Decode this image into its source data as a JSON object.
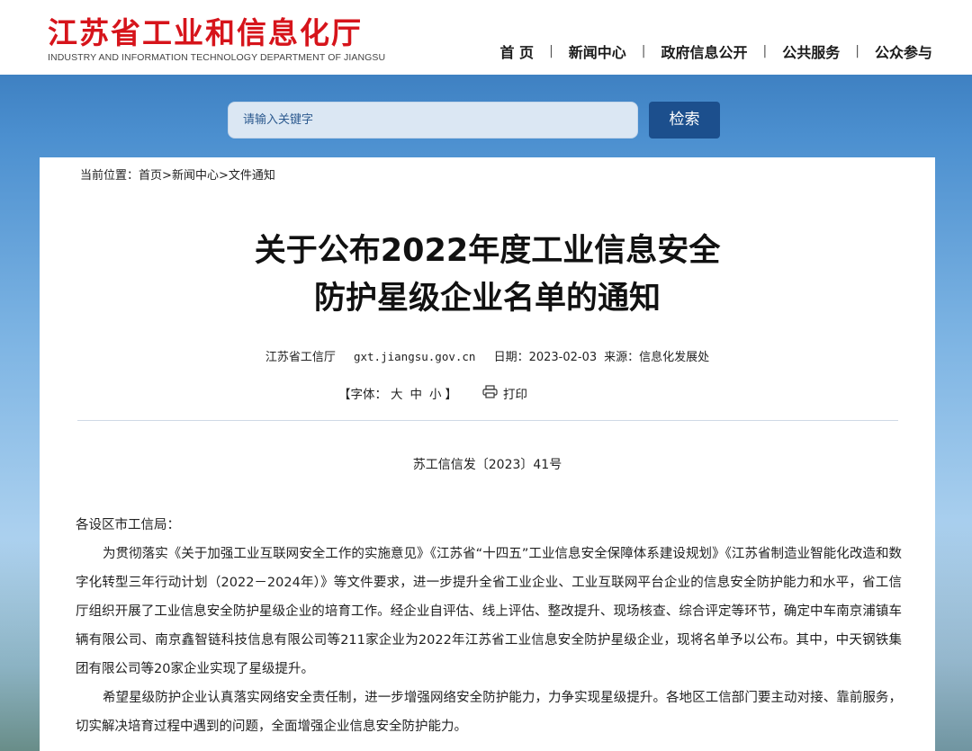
{
  "header": {
    "logo_cn": "江苏省工业和信息化厅",
    "logo_en": "INDUSTRY AND INFORMATION TECHNOLOGY DEPARTMENT OF JIANGSU",
    "nav": [
      "首 页",
      "新闻中心",
      "政府信息公开",
      "公共服务",
      "公众参与"
    ],
    "nav_separator": "|"
  },
  "search": {
    "placeholder": "请输入关键字",
    "button_label": "检索"
  },
  "breadcrumb": {
    "prefix": "当前位置：",
    "items": [
      "首页",
      "新闻中心",
      "文件通知"
    ],
    "separator": ">"
  },
  "article": {
    "title_line1": "关于公布2022年度工业信息安全",
    "title_line2": "防护星级企业名单的通知",
    "publisher": "江苏省工信厅",
    "site": "gxt.jiangsu.gov.cn",
    "date": "日期：2023-02-03",
    "source": "来源：信息化发展处",
    "font_prefix": "【字体：",
    "font_sizes": [
      "大",
      "中",
      "小"
    ],
    "font_suffix": "】",
    "print_label": "打印",
    "doc_number": "苏工信信发〔2023〕41号",
    "salutation": "各设区市工信局：",
    "para1": "为贯彻落实《关于加强工业互联网安全工作的实施意见》《江苏省“十四五”工业信息安全保障体系建设规划》《江苏省制造业智能化改造和数字化转型三年行动计划（2022－2024年）》等文件要求，进一步提升全省工业企业、工业互联网平台企业的信息安全防护能力和水平，省工信厅组织开展了工业信息安全防护星级企业的培育工作。经企业自评估、线上评估、整改提升、现场核查、综合评定等环节，确定中车南京浦镇车辆有限公司、南京鑫智链科技信息有限公司等211家企业为2022年江苏省工业信息安全防护星级企业，现将名单予以公布。其中，中天钢铁集团有限公司等20家企业实现了星级提升。",
    "para2": "希望星级防护企业认真落实网络安全责任制，进一步增强网络安全防护能力，力争实现星级提升。各地区工信部门要主动对接、靠前服务，切实解决培育过程中遇到的问题，全面增强企业信息安全防护能力。"
  },
  "colors": {
    "logo_red": "#d6141b",
    "search_button": "#1c4f8d",
    "background_blue": "#4b8fcf"
  }
}
